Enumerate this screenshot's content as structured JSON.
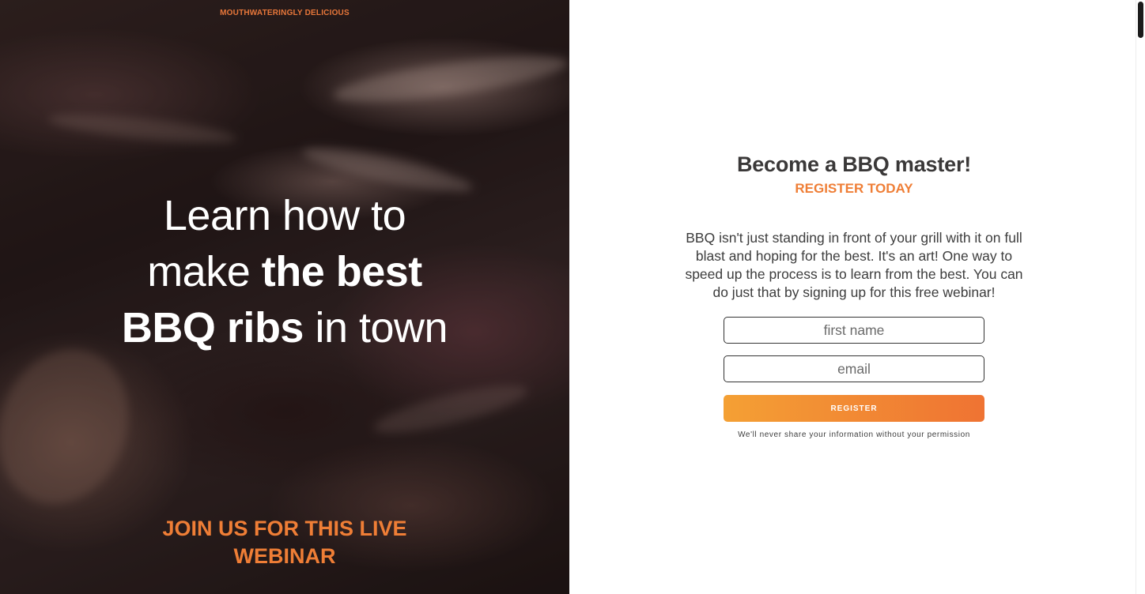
{
  "hero": {
    "eyebrow": "MOUTHWATERINGLY DELICIOUS",
    "title_line1": "Learn how to",
    "title_line2_regular": "make ",
    "title_line2_bold": "the best",
    "title_line3_bold": "BBQ ribs",
    "title_line3_regular": " in town",
    "cta_line1": "JOIN US FOR THIS LIVE",
    "cta_line2": "WEBINAR"
  },
  "form": {
    "title": "Become a BBQ master!",
    "subtitle": "REGISTER TODAY",
    "description": "BBQ isn't just standing in front of your grill with it on full blast and hoping for the best. It's an art! One way to speed up the process is to learn from the best. You can do just that by signing up for this free webinar!",
    "first_name_placeholder": "first name",
    "email_placeholder": "email",
    "register_label": "REGISTER",
    "privacy_note": "We'll never share your information without your permission"
  },
  "colors": {
    "accent": "#ef7e36",
    "button_start": "#f4a034",
    "button_end": "#ef7333",
    "heading": "#3a3838"
  }
}
